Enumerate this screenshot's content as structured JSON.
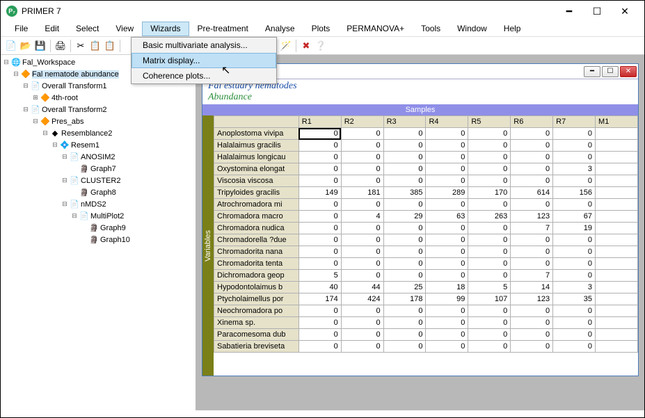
{
  "app": {
    "title": "PRIMER 7"
  },
  "menu": [
    "File",
    "Edit",
    "Select",
    "View",
    "Wizards",
    "Pre-treatment",
    "Analyse",
    "Plots",
    "PERMANOVA+",
    "Tools",
    "Window",
    "Help"
  ],
  "menu_active": "Wizards",
  "dropdown": {
    "items": [
      "Basic multivariate analysis...",
      "Matrix display...",
      "Coherence plots..."
    ],
    "hover": 1
  },
  "tree": [
    {
      "d": 0,
      "ic": "🌐",
      "lbl": "Fal_Workspace",
      "exp": "-"
    },
    {
      "d": 1,
      "ic": "🔶",
      "lbl": "Fal nematode abundance",
      "exp": "-",
      "sel": true
    },
    {
      "d": 2,
      "ic": "📄",
      "lbl": "Overall Transform1",
      "exp": "-"
    },
    {
      "d": 3,
      "ic": "🔶",
      "lbl": "4th-root",
      "exp": "+"
    },
    {
      "d": 2,
      "ic": "📄",
      "lbl": "Overall Transform2",
      "exp": "-"
    },
    {
      "d": 3,
      "ic": "🔶",
      "lbl": "Pres_abs",
      "exp": "-"
    },
    {
      "d": 4,
      "ic": "◆",
      "lbl": "Resemblance2",
      "exp": "-"
    },
    {
      "d": 5,
      "ic": "💠",
      "lbl": "Resem1",
      "exp": "-"
    },
    {
      "d": 6,
      "ic": "📄",
      "lbl": "ANOSIM2",
      "exp": "-"
    },
    {
      "d": 7,
      "ic": "🗿",
      "lbl": "Graph7",
      "exp": ""
    },
    {
      "d": 6,
      "ic": "📄",
      "lbl": "CLUSTER2",
      "exp": "-"
    },
    {
      "d": 7,
      "ic": "🗿",
      "lbl": "Graph8",
      "exp": ""
    },
    {
      "d": 6,
      "ic": "📄",
      "lbl": "nMDS2",
      "exp": "-"
    },
    {
      "d": 7,
      "ic": "📄",
      "lbl": "MultiPlot2",
      "exp": "-"
    },
    {
      "d": 8,
      "ic": "🗿",
      "lbl": "Graph9",
      "exp": ""
    },
    {
      "d": 8,
      "ic": "🗿",
      "lbl": "Graph10",
      "exp": ""
    }
  ],
  "doc": {
    "title1": "Fal estuary nematodes",
    "title2": "Abundance",
    "samples_label": "Samples",
    "variables_label": "Variables",
    "columns": [
      "R1",
      "R2",
      "R3",
      "R4",
      "R5",
      "R6",
      "R7",
      "M1"
    ],
    "rows": [
      {
        "n": "Anoplostoma vivipa",
        "v": [
          0,
          0,
          0,
          0,
          0,
          0,
          0
        ]
      },
      {
        "n": "Halalaimus gracilis",
        "v": [
          0,
          0,
          0,
          0,
          0,
          0,
          0
        ]
      },
      {
        "n": "Halalaimus longicau",
        "v": [
          0,
          0,
          0,
          0,
          0,
          0,
          0
        ]
      },
      {
        "n": "Oxystomina elongat",
        "v": [
          0,
          0,
          0,
          0,
          0,
          0,
          3
        ]
      },
      {
        "n": "Viscosia viscosa",
        "v": [
          0,
          0,
          0,
          0,
          0,
          0,
          0
        ]
      },
      {
        "n": "Tripyloides gracilis",
        "v": [
          149,
          181,
          385,
          289,
          170,
          614,
          156
        ]
      },
      {
        "n": "Atrochromadora mi",
        "v": [
          0,
          0,
          0,
          0,
          0,
          0,
          0
        ]
      },
      {
        "n": "Chromadora macro",
        "v": [
          0,
          4,
          29,
          63,
          263,
          123,
          67
        ]
      },
      {
        "n": "Chromadora nudica",
        "v": [
          0,
          0,
          0,
          0,
          0,
          7,
          19
        ]
      },
      {
        "n": "Chromadorella ?due",
        "v": [
          0,
          0,
          0,
          0,
          0,
          0,
          0
        ]
      },
      {
        "n": "Chromadorita nana",
        "v": [
          0,
          0,
          0,
          0,
          0,
          0,
          0
        ]
      },
      {
        "n": "Chromadorita tenta",
        "v": [
          0,
          0,
          0,
          0,
          0,
          0,
          0
        ]
      },
      {
        "n": "Dichromadora geop",
        "v": [
          5,
          0,
          0,
          0,
          0,
          7,
          0
        ]
      },
      {
        "n": "Hypodontolaimus b",
        "v": [
          40,
          44,
          25,
          18,
          5,
          14,
          3
        ]
      },
      {
        "n": "Ptycholaimellus por",
        "v": [
          174,
          424,
          178,
          99,
          107,
          123,
          35
        ]
      },
      {
        "n": "Neochromadora po",
        "v": [
          0,
          0,
          0,
          0,
          0,
          0,
          0
        ]
      },
      {
        "n": "Xinema sp.",
        "v": [
          0,
          0,
          0,
          0,
          0,
          0,
          0
        ]
      },
      {
        "n": "Paracomesoma dub",
        "v": [
          0,
          0,
          0,
          0,
          0,
          0,
          0
        ]
      },
      {
        "n": "Sabatieria breviseta",
        "v": [
          0,
          0,
          0,
          0,
          0,
          0,
          0
        ]
      }
    ]
  }
}
